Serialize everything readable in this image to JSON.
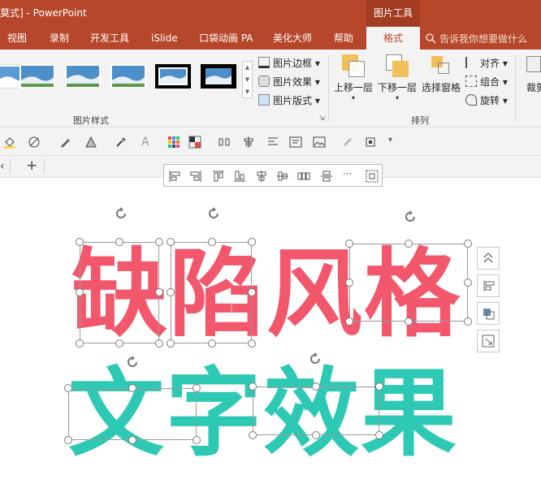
{
  "titlebar": {
    "title": "莫式] - PowerPoint",
    "context_tab": "图片工具"
  },
  "tabs": [
    {
      "label": "视图"
    },
    {
      "label": "录制"
    },
    {
      "label": "开发工具"
    },
    {
      "label": "iSlide"
    },
    {
      "label": "口袋动画 PA"
    },
    {
      "label": "美化大师"
    },
    {
      "label": "帮助"
    },
    {
      "label": "格式"
    }
  ],
  "tellme": {
    "placeholder": "告诉我你想要做什么"
  },
  "ribbon": {
    "picture_border": "图片边框",
    "picture_effects": "图片效果",
    "picture_layout": "图片版式",
    "group_styles": "图片样式",
    "bring_forward": "上移一层",
    "send_backward": "下移一层",
    "selection_pane": "选择窗格",
    "align": "对齐",
    "group": "组合",
    "rotate": "旋转",
    "group_arrange": "排列",
    "crop": "裁剪"
  },
  "slide": {
    "line1": "缺陷风格",
    "line2": "文字效果",
    "line1_color": "#f2576b",
    "line2_color": "#2ec9b4"
  },
  "icons": [
    "rotate-handle-icon",
    "align-left-icon",
    "align-right-icon",
    "add-tab-icon"
  ]
}
